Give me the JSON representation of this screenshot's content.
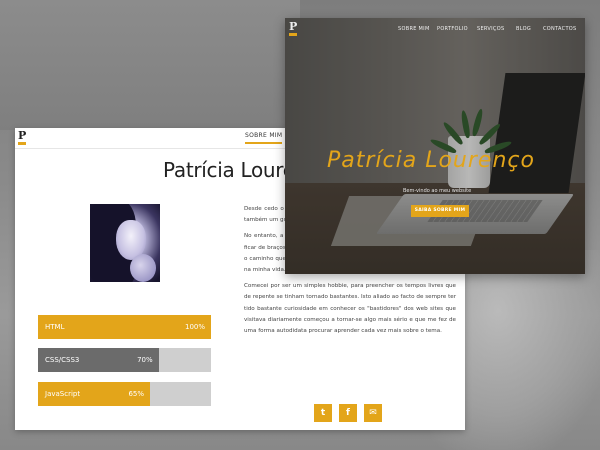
{
  "about_page": {
    "logo_letter": "P",
    "nav": {
      "active_item": "SOBRE MIM"
    },
    "title": "Patrícia Louren",
    "skills": [
      {
        "name": "HTML",
        "percent_label": "100%",
        "level": 1.0,
        "color": "#e3a51a"
      },
      {
        "name": "CSS/CSS3",
        "percent_label": "70%",
        "level": 0.7,
        "color": "#6b6b6b"
      },
      {
        "name": "JavaScript",
        "percent_label": "65%",
        "level": 0.65,
        "color": "#e3a51a"
      }
    ],
    "paragraphs": [
      "Desde cedo o meu interesse pela tecnologia foi notável. Nomeadamente também um gosto enorme contabilidade, hora de escolher.",
      "No entanto, a vida tem destas coisas, nossa vida e não sendo pessoa de ficar de braços cruzados perante as adversidades, vi-me obrigado a alterar o caminho que tinha traçado inicialmente e é aqui que o Web design entra na minha vida.",
      "Comecei por ser um simples hobbie, para preencher os tempos livres que de repente se tinham tornado bastantes. Isto aliado ao facto de sempre ter tido bastante curiosidade em conhecer os \"bastidores\" dos web sites que visitava diariamente começou a tornar-se algo mais sério e que me fez de uma forma autodidata procurar aprender cada vez mais sobre o tema."
    ],
    "social": [
      {
        "icon": "twitter-icon",
        "glyph": "t"
      },
      {
        "icon": "facebook-icon",
        "glyph": "f"
      },
      {
        "icon": "email-icon",
        "glyph": "✉"
      }
    ]
  },
  "hero_page": {
    "logo_letter": "P",
    "nav_items": [
      "SOBRE MIM",
      "PORTFOLIO",
      "SERVIÇOS",
      "BLOG",
      "CONTACTOS"
    ],
    "title": "Patrícia Lourenço",
    "subtitle": "Bem-vindo ao meu website",
    "cta_label": "SAIBA SOBRE MIM"
  },
  "colors": {
    "accent": "#e3a51a",
    "skill_track": "#cfcfcf"
  }
}
